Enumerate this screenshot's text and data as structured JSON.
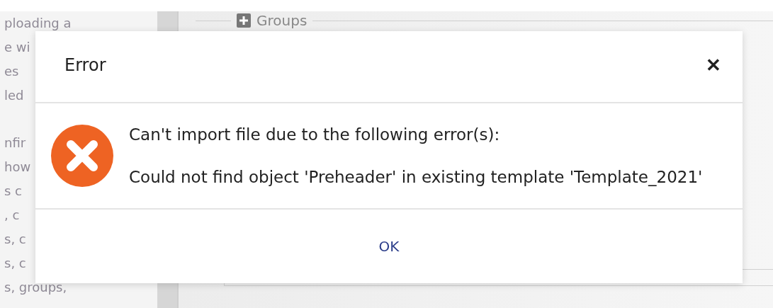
{
  "background": {
    "text_lines": [
      {
        "text": "ploading a",
        "gap_before": false
      },
      {
        "text": "e wi",
        "gap_before": false
      },
      {
        "text": "es",
        "gap_before": false
      },
      {
        "text": "led",
        "gap_before": false
      },
      {
        "text": "nfir",
        "gap_before": true
      },
      {
        "text": "how",
        "gap_before": false
      },
      {
        "text": "s c",
        "gap_before": false
      },
      {
        "text": ", c",
        "gap_before": false
      },
      {
        "text": "s, c",
        "gap_before": false
      },
      {
        "text": "s, c",
        "gap_before": false
      },
      {
        "text": "s, groups,",
        "gap_before": false
      }
    ],
    "section": {
      "title": "Groups"
    }
  },
  "dialog": {
    "title": "Error",
    "close": "✕",
    "messages": [
      "Can't import file due to the following error(s):",
      "Could not find object 'Preheader' in existing template 'Template_2021'"
    ],
    "buttons": [
      "OK"
    ]
  }
}
